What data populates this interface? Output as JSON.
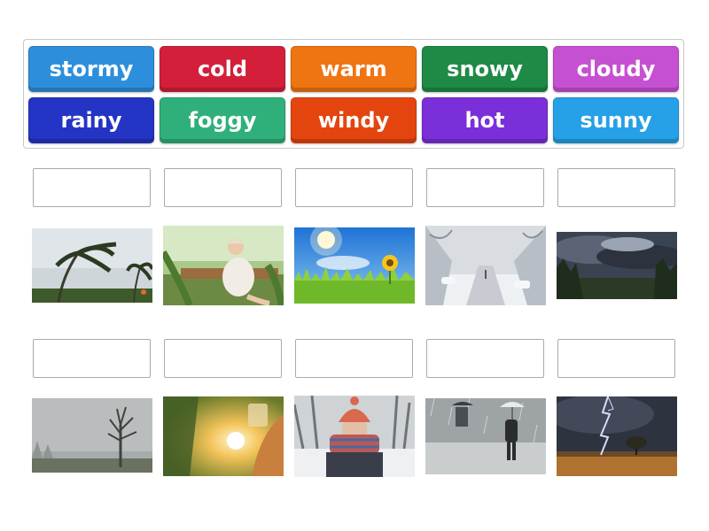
{
  "word_bank": {
    "tiles": [
      {
        "label": "stormy",
        "color": "#2d8fdc"
      },
      {
        "label": "cold",
        "color": "#d31f3a"
      },
      {
        "label": "warm",
        "color": "#ef7412"
      },
      {
        "label": "snowy",
        "color": "#1e8a46"
      },
      {
        "label": "cloudy",
        "color": "#c650d2"
      },
      {
        "label": "rainy",
        "color": "#2434c4"
      },
      {
        "label": "foggy",
        "color": "#2fb07a"
      },
      {
        "label": "windy",
        "color": "#e4450f"
      },
      {
        "label": "hot",
        "color": "#7b2fd8"
      },
      {
        "label": "sunny",
        "color": "#26a0e6"
      }
    ]
  },
  "pictures": [
    "palm-trees-in-wind-image",
    "woman-relaxing-outdoors-image",
    "sunflower-blue-sky-image",
    "snowy-street-image",
    "dark-clouds-image",
    "foggy-tree-image",
    "sun-glare-image",
    "person-in-winter-scarf-image",
    "people-in-rain-image",
    "lightning-storm-image"
  ]
}
